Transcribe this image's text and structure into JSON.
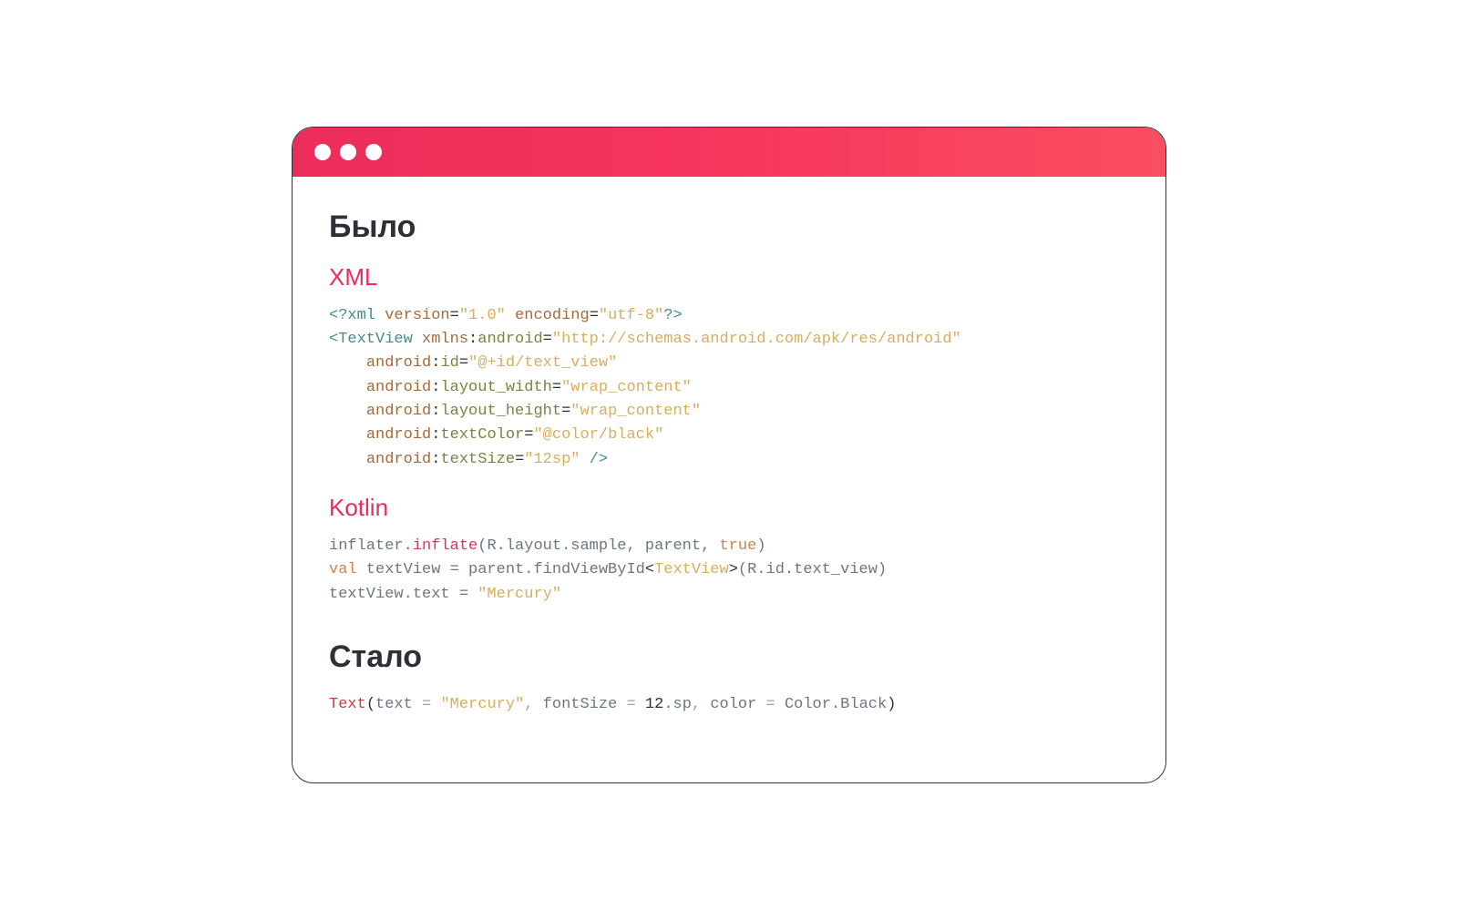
{
  "headings": {
    "before": "Было",
    "after": "Стало"
  },
  "subheadings": {
    "xml": "XML",
    "kotlin": "Kotlin"
  },
  "xml": {
    "decl": {
      "open": "<?",
      "name": "xml",
      "sep1": " ",
      "attr1_name": "version",
      "eq": "=",
      "attr1_val": "\"1.0\"",
      "sep2": " ",
      "attr2_name": "encoding",
      "attr2_val": "\"utf-8\"",
      "close": "?>"
    },
    "tag": {
      "lt": "<",
      "name": "TextView",
      "sep": " ",
      "ns_prefix": "xmlns",
      "ns_colon": ":",
      "ns_suffix": "android",
      "ns_val": "\"http://schemas.android.com/apk/res/android\"",
      "attrs": [
        {
          "indent": "    ",
          "prefix": "android",
          "colon": ":",
          "name": "id",
          "eq": "=",
          "val": "\"@+id/text_view\""
        },
        {
          "indent": "    ",
          "prefix": "android",
          "colon": ":",
          "name": "layout_width",
          "eq": "=",
          "val": "\"wrap_content\""
        },
        {
          "indent": "    ",
          "prefix": "android",
          "colon": ":",
          "name": "layout_height",
          "eq": "=",
          "val": "\"wrap_content\""
        },
        {
          "indent": "    ",
          "prefix": "android",
          "colon": ":",
          "name": "textColor",
          "eq": "=",
          "val": "\"@color/black\""
        },
        {
          "indent": "    ",
          "prefix": "android",
          "colon": ":",
          "name": "textSize",
          "eq": "=",
          "val": "\"12sp\""
        }
      ],
      "close": " />"
    }
  },
  "kotlin": {
    "l1": {
      "a": "inflater.",
      "b": "inflate",
      "c": "(R.layout.sample, parent, ",
      "d": "true",
      "e": ")"
    },
    "l2": {
      "a": "val",
      "b": " textView = parent.findViewById",
      "lt": "<",
      "t": "TextView",
      "gt": ">",
      "c": "(R.id.text_view)"
    },
    "l3": {
      "a": "textView.text = ",
      "b": "\"Mercury\""
    }
  },
  "compose": {
    "fn": "Text",
    "open": "(",
    "p1_name": "text",
    "eq": " = ",
    "p1_val": "\"Mercury\"",
    "comma": ", ",
    "p2_name": "fontSize",
    "p2_num": "12",
    "p2_dot": ".sp",
    "p3_name": "color",
    "p3_type": "Color",
    "p3_acc": ".Black",
    "close": ")"
  }
}
